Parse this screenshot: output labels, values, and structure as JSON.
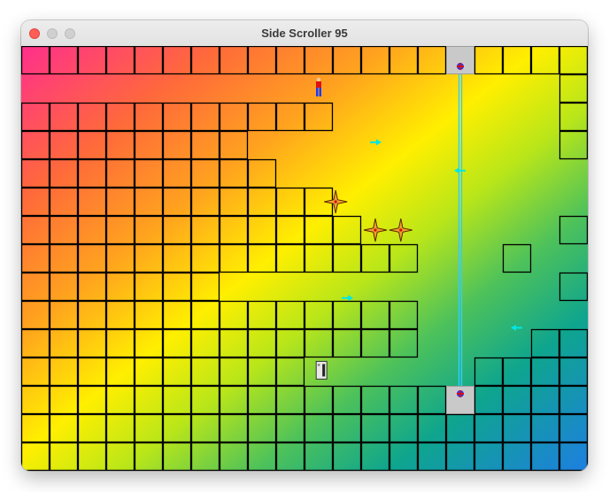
{
  "window": {
    "title": "Side Scroller 95"
  },
  "colors": {
    "tile_border": "#000000",
    "platform": "#c9c9c9",
    "rail": "#33ccff",
    "bullet": "#00e6e6",
    "star": "#f0a030",
    "player_shirt": "#e01010",
    "player_pants": "#1a3cff"
  },
  "level": {
    "grid": {
      "columns": 20,
      "rows": 15
    },
    "tile_rows": [
      "XXXXXXXXXXXXXXX.XXXX",
      "...................X",
      "XXXXXXXXXXX........X",
      "XXXXXXXX...........X",
      "XXXXXXXXX...........",
      "XXXXXXXXXXX.........",
      "XXXXXXXXXXXX.......X",
      "XXXXXXXXXXXXXX...X..",
      "XXXXXXX............X",
      "XXXXXXXXXXXXXX......",
      "XXXXXXXXXXXXXX....XX",
      "XXXXXXXXXX......XXXX",
      "XXXXXXXXXXXXXXX.XXXX",
      "XXXXXXXXXXXXXXXXXXXX",
      "XXXXXXXXXXXXXXXXXXXX"
    ],
    "elevator": {
      "column": 15,
      "top_row": 0,
      "bottom_row": 12,
      "platform_icon": "elevator-platform",
      "rail_icon": "elevator-rail"
    },
    "player": {
      "icon": "player-sprite",
      "column": 10.5,
      "row": 1.5
    },
    "stars": [
      {
        "icon": "spiky-star",
        "column": 11.1,
        "row": 5.5
      },
      {
        "icon": "spiky-star",
        "column": 12.5,
        "row": 6.5
      },
      {
        "icon": "spiky-star",
        "column": 13.4,
        "row": 6.5
      }
    ],
    "bullets": [
      {
        "icon": "cyan-bullet",
        "column": 12.5,
        "row": 3.4,
        "direction": "right"
      },
      {
        "icon": "cyan-bullet",
        "column": 15.5,
        "row": 4.4,
        "direction": "left"
      },
      {
        "icon": "cyan-bullet",
        "column": 11.5,
        "row": 8.9,
        "direction": "right"
      },
      {
        "icon": "cyan-bullet",
        "column": 17.5,
        "row": 9.95,
        "direction": "left"
      }
    ],
    "switch": {
      "icon": "wall-switch",
      "column": 10.6,
      "row": 11.45
    }
  }
}
